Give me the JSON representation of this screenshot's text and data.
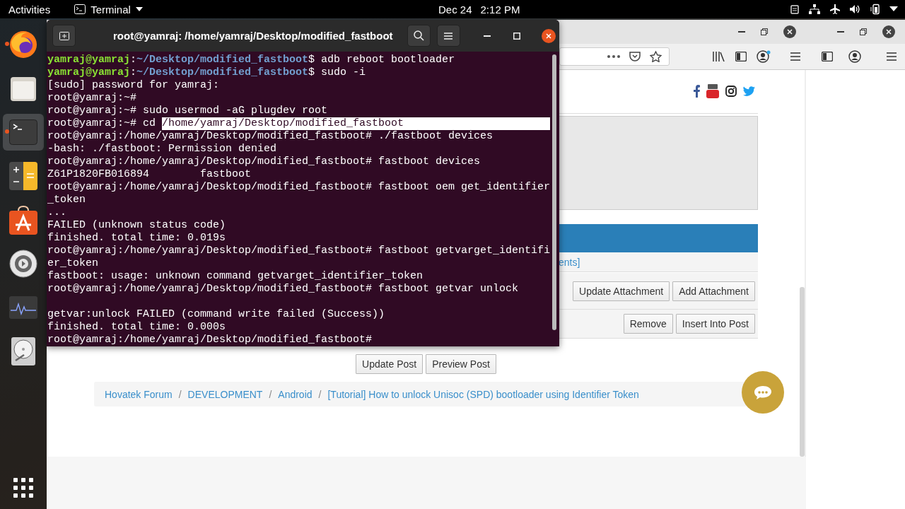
{
  "top_bar": {
    "activities": "Activities",
    "app_menu": "Terminal",
    "date": "Dec 24",
    "time": "2:12 PM"
  },
  "dock": [
    {
      "kind": "firefox",
      "running": true,
      "selected": false
    },
    {
      "kind": "files",
      "running": false,
      "selected": false
    },
    {
      "kind": "terminal",
      "running": true,
      "selected": true
    },
    {
      "kind": "calculator",
      "running": false,
      "selected": false
    },
    {
      "kind": "software",
      "running": false,
      "selected": false
    },
    {
      "kind": "settings",
      "running": false,
      "selected": false
    },
    {
      "kind": "monitor",
      "running": false,
      "selected": false
    },
    {
      "kind": "disk",
      "running": false,
      "selected": false
    }
  ],
  "terminal": {
    "title": "root@yamraj: /home/yamraj/Desktop/modified_fastboot",
    "lines": [
      {
        "segments": [
          {
            "kind": "user",
            "text": "yamraj@yamraj"
          },
          {
            "kind": "plain",
            "text": ":"
          },
          {
            "kind": "path",
            "text": "~/Desktop/modified_fastboot"
          },
          {
            "kind": "plain",
            "text": "$ adb reboot bootloader"
          }
        ]
      },
      {
        "segments": [
          {
            "kind": "user",
            "text": "yamraj@yamraj"
          },
          {
            "kind": "plain",
            "text": ":"
          },
          {
            "kind": "path",
            "text": "~/Desktop/modified_fastboot"
          },
          {
            "kind": "plain",
            "text": "$ sudo -i"
          }
        ]
      },
      {
        "segments": [
          {
            "kind": "plain",
            "text": "[sudo] password for yamraj:"
          }
        ]
      },
      {
        "segments": [
          {
            "kind": "plain",
            "text": "root@yamraj:~#"
          }
        ]
      },
      {
        "segments": [
          {
            "kind": "plain",
            "text": "root@yamraj:~# sudo usermod -aG plugdev root"
          }
        ]
      },
      {
        "segments": [
          {
            "kind": "plain",
            "text": "root@yamraj:~# cd "
          },
          {
            "kind": "selected",
            "text": "/home/yamraj/Desktop/modified_fastboot"
          }
        ]
      },
      {
        "segments": [
          {
            "kind": "plain",
            "text": "root@yamraj:/home/yamraj/Desktop/modified_fastboot# ./fastboot devices"
          }
        ]
      },
      {
        "segments": [
          {
            "kind": "plain",
            "text": "-bash: ./fastboot: Permission denied"
          }
        ]
      },
      {
        "segments": [
          {
            "kind": "plain",
            "text": "root@yamraj:/home/yamraj/Desktop/modified_fastboot# fastboot devices"
          }
        ]
      },
      {
        "segments": [
          {
            "kind": "plain",
            "text": "Z61P1820FB016894        fastboot"
          }
        ]
      },
      {
        "segments": [
          {
            "kind": "plain",
            "text": "root@yamraj:/home/yamraj/Desktop/modified_fastboot# fastboot oem get_identifier"
          }
        ]
      },
      {
        "segments": [
          {
            "kind": "plain",
            "text": "_token"
          }
        ]
      },
      {
        "segments": [
          {
            "kind": "plain",
            "text": "..."
          }
        ]
      },
      {
        "segments": [
          {
            "kind": "plain",
            "text": "FAILED (unknown status code)"
          }
        ]
      },
      {
        "segments": [
          {
            "kind": "plain",
            "text": "finished. total time: 0.019s"
          }
        ]
      },
      {
        "segments": [
          {
            "kind": "plain",
            "text": "root@yamraj:/home/yamraj/Desktop/modified_fastboot# fastboot getvarget_identifi"
          }
        ]
      },
      {
        "segments": [
          {
            "kind": "plain",
            "text": "er_token"
          }
        ]
      },
      {
        "segments": [
          {
            "kind": "plain",
            "text": "fastboot: usage: unknown command getvarget_identifier_token"
          }
        ]
      },
      {
        "segments": [
          {
            "kind": "plain",
            "text": "root@yamraj:/home/yamraj/Desktop/modified_fastboot# fastboot getvar unlock"
          }
        ]
      },
      {
        "kind": "blank"
      },
      {
        "segments": [
          {
            "kind": "plain",
            "text": "getvar:unlock FAILED (command write failed (Success))"
          }
        ]
      },
      {
        "segments": [
          {
            "kind": "plain",
            "text": "finished. total time: 0.000s"
          }
        ]
      },
      {
        "segments": [
          {
            "kind": "plain",
            "text": "root@yamraj:/home/yamraj/Desktop/modified_fastboot#"
          }
        ]
      }
    ]
  },
  "browser": {
    "page": {
      "attachments_link": "ents]",
      "attachment_buttons": [
        "Update Attachment",
        "Add Attachment"
      ],
      "attachment_actions": [
        "Remove",
        "Insert Into Post"
      ],
      "post_buttons": [
        "Update Post",
        "Preview Post"
      ],
      "breadcrumb": {
        "separator": "/",
        "items": [
          "Hovatek Forum",
          "DEVELOPMENT",
          "Android",
          "[Tutorial] How to unlock Unisoc (SPD) bootloader using Identifier Token"
        ]
      }
    }
  }
}
